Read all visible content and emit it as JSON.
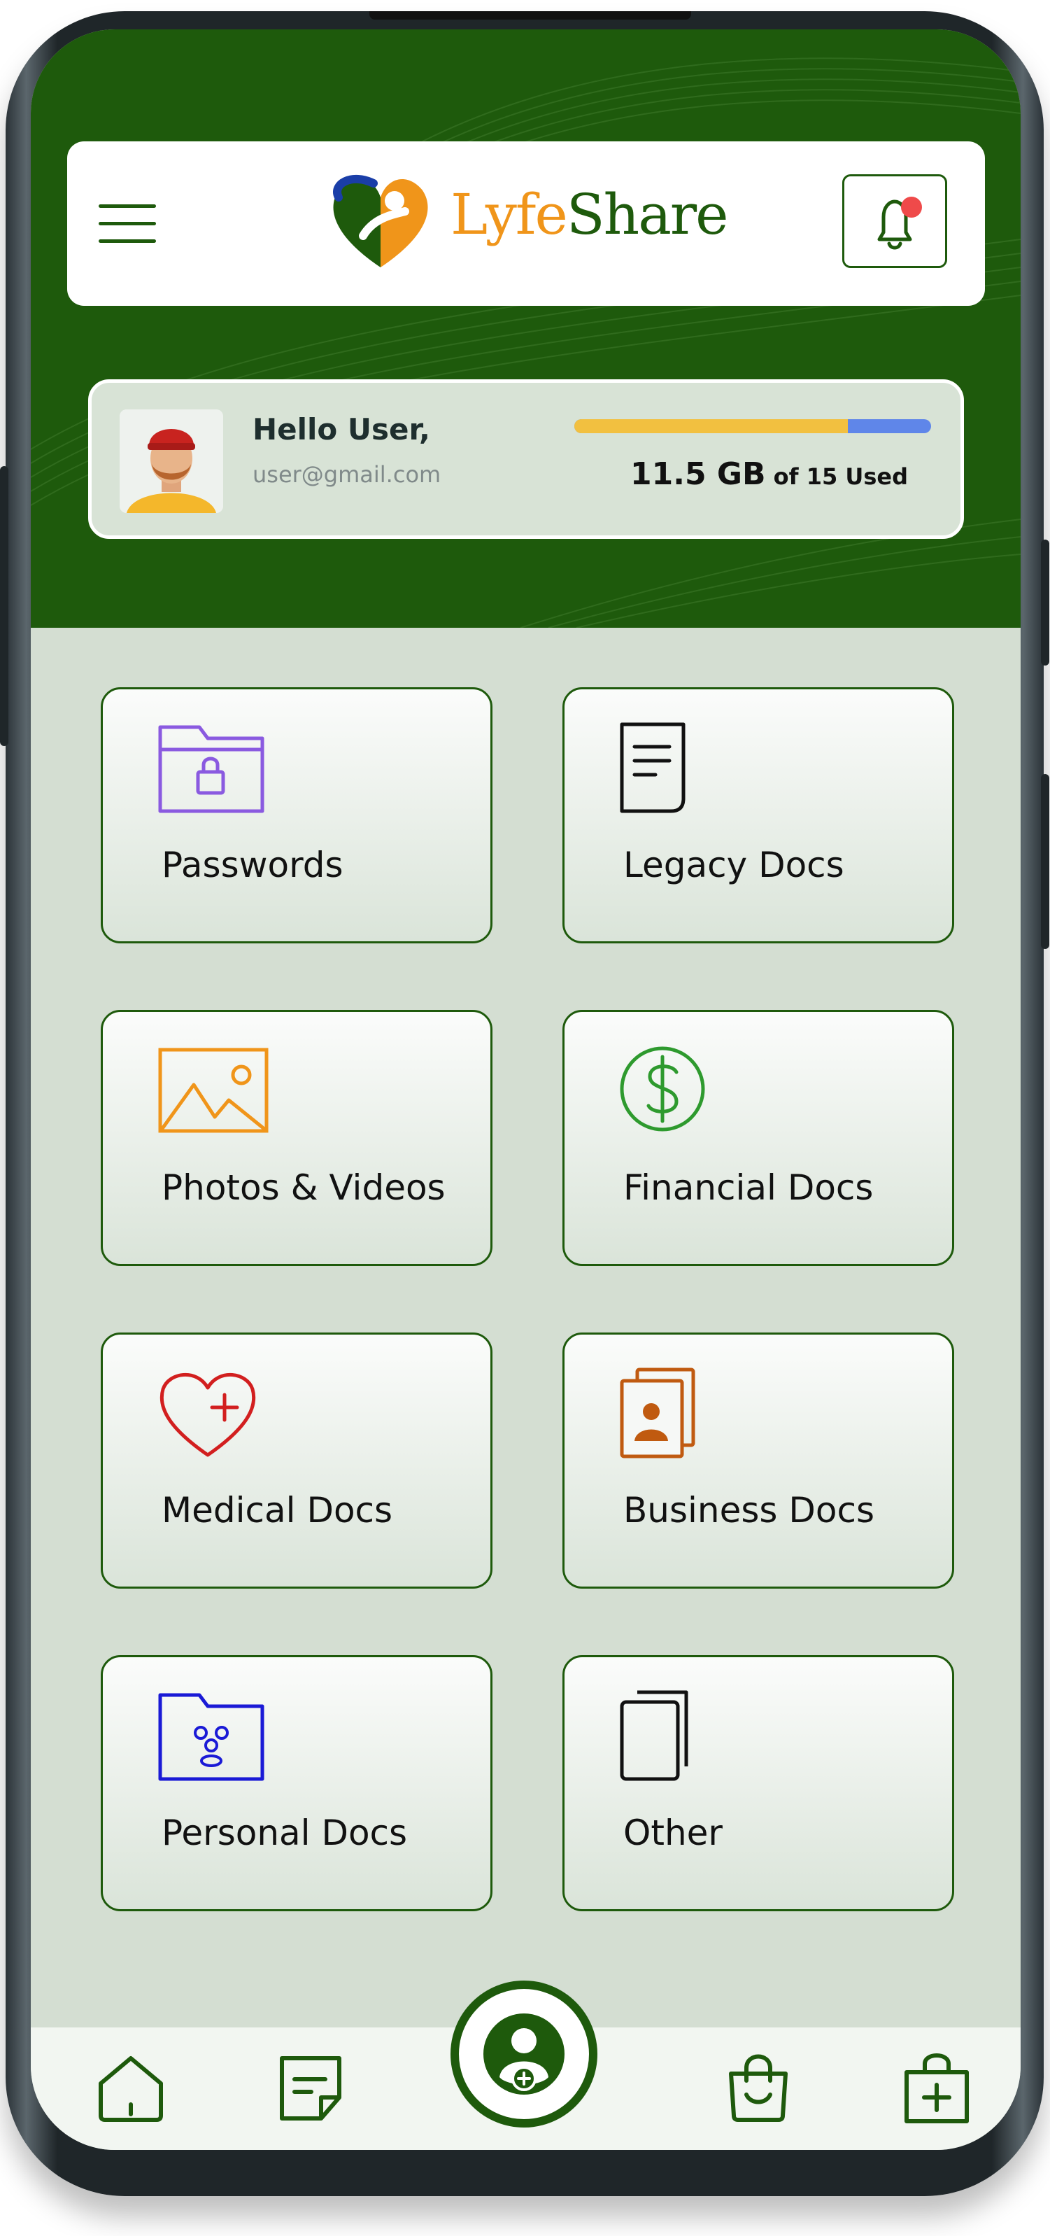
{
  "app": {
    "name_part1": "Lyfe",
    "name_part2": "Share"
  },
  "header": {
    "menu_icon": "hamburger-icon",
    "notification_icon": "bell-icon"
  },
  "user": {
    "greeting": "Hello User,",
    "email": "user@gmail.com"
  },
  "storage": {
    "used_fraction": 0.7667,
    "used_value": "11.5 GB",
    "used_suffix": " of 15 Used"
  },
  "colors": {
    "brand_green": "#1e5a0c",
    "accent_orange": "#f0951a",
    "storage_fill": "#f2c040",
    "storage_track": "#5f86e9",
    "notification_dot": "#ef4a4a"
  },
  "categories": [
    {
      "label": "Passwords",
      "icon": "locked-folder-icon",
      "color": "#8a5ae0"
    },
    {
      "label": "Legacy Docs",
      "icon": "document-icon",
      "color": "#111111"
    },
    {
      "label": "Photos & Videos",
      "icon": "image-icon",
      "color": "#f0951a"
    },
    {
      "label": "Financial Docs",
      "icon": "dollar-icon",
      "color": "#2e9a2e"
    },
    {
      "label": "Medical Docs",
      "icon": "heart-plus-icon",
      "color": "#d21f1f"
    },
    {
      "label": "Business Docs",
      "icon": "id-cards-icon",
      "color": "#c05a10"
    },
    {
      "label": "Personal Docs",
      "icon": "people-folder-icon",
      "color": "#1a1ad6"
    },
    {
      "label": "Other",
      "icon": "stacked-pages-icon",
      "color": "#111111"
    }
  ],
  "bottom_nav": [
    "home-icon",
    "notes-icon",
    "profile-add-icon",
    "shopping-bag-icon",
    "medical-bag-icon"
  ]
}
